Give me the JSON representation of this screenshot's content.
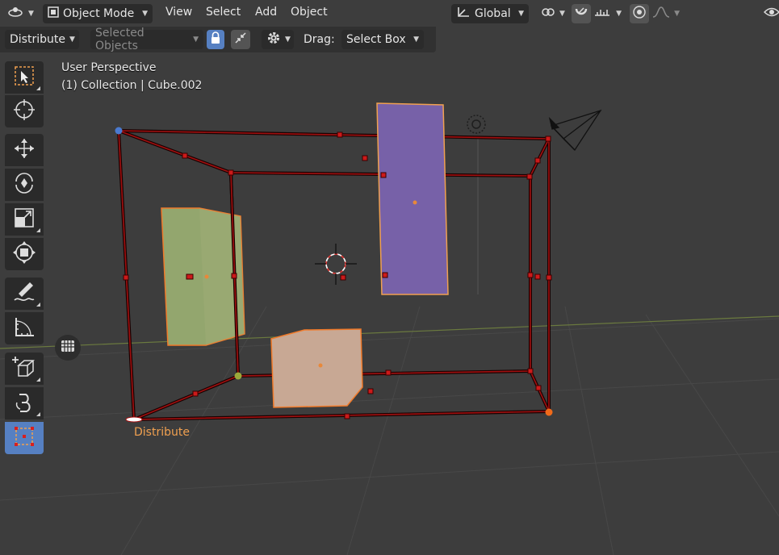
{
  "header": {
    "editor_type_icon": "orbit-editor-icon",
    "mode": "Object Mode",
    "menus": [
      "View",
      "Select",
      "Add",
      "Object"
    ],
    "transform_orientation": "Global"
  },
  "tool_settings": {
    "operator": "Distribute",
    "target": "Selected Objects",
    "drag_label": "Drag:",
    "drag_value": "Select Box"
  },
  "viewport": {
    "perspective": "User Perspective",
    "collection": "(1) Collection | Cube.002",
    "operator_label": "Distribute"
  },
  "toolbar": {
    "tools": [
      "select-box-icon",
      "cursor-icon",
      "move-icon",
      "rotate-icon",
      "scale-icon",
      "transform-icon",
      "annotate-icon",
      "measure-icon",
      "add-cube-icon",
      "spin-icon",
      "distribute-icon"
    ],
    "active_tool": "distribute-icon"
  },
  "colors": {
    "viewport_bg": "#3d3d3d",
    "accent": "#5680c2",
    "bbox_line": "#8a0d0d",
    "handle": "#cc1a1a",
    "plane_green": "#93a66e",
    "plane_purple": "#7761a8",
    "plane_peach": "#c8a894",
    "selection_outline": "#f0a050"
  }
}
